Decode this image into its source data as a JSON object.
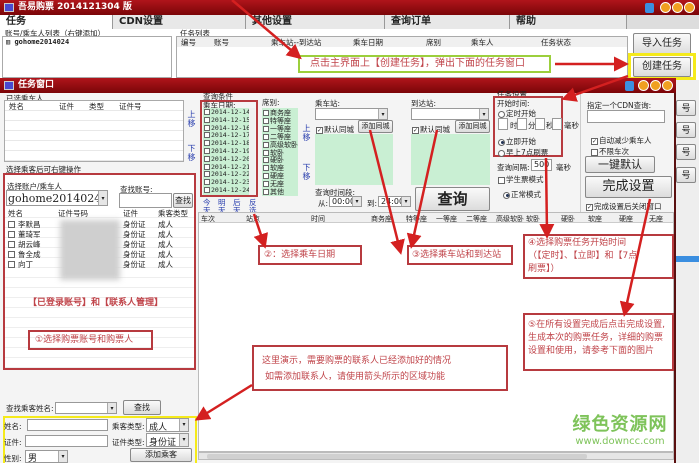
{
  "main_window": {
    "title": "吾易购票 2014121304 版",
    "tabs": [
      "任务",
      "CDN设置",
      "其他设置",
      "查询订单",
      "帮助"
    ],
    "account_list_label": "账号/乘车人列表（右键添加）",
    "account_item": "gohome2014024",
    "task_list_label": "任务列表",
    "task_list_headers": [
      "编号",
      "账号",
      "乘车站--到达站",
      "乘车日期",
      "席别",
      "乘车人",
      "任务状态"
    ],
    "import_task_button": "导入任务",
    "create_task_button": "创建任务",
    "side_button_fragment": "号"
  },
  "task_window": {
    "title": "任务窗口",
    "selected_passengers_label": "已选乘车人",
    "selected_headers": [
      "姓名",
      "证件",
      "类型",
      "证件号"
    ],
    "move_up": "上移",
    "move_down": "下移",
    "right_click_hint": "选择乘客后可右键操作",
    "select_account_label": "选择账户/乘车人",
    "account_value": "gohome2014024",
    "find_account_label": "查找账号:",
    "find_button": "查找",
    "passenger_headers": [
      "姓名",
      "证件号码",
      "证件",
      "乘客类型"
    ],
    "passengers": [
      {
        "name": "李默昌",
        "id_type": "身份证",
        "type": "成人"
      },
      {
        "name": "董琦军",
        "id_type": "身份证",
        "type": "成人"
      },
      {
        "name": "胡云峰",
        "id_type": "身份证",
        "type": "成人"
      },
      {
        "name": "鲁全成",
        "id_type": "身份证",
        "type": "成人"
      },
      {
        "name": "向丁",
        "id_type": "身份证",
        "type": "成人"
      }
    ],
    "find_passenger_label": "查找乘客姓名:",
    "add_form": {
      "name_label": "姓名:",
      "id_label": "证件:",
      "gender_label": "性别:",
      "gender_value": "男",
      "passenger_type_label": "乘客类型:",
      "passenger_type_value": "成人",
      "id_type_label": "证件类型:",
      "id_type_value": "身份证",
      "add_button": "添加乘客"
    },
    "query": {
      "label": "查询条件",
      "date_label": "乘车日期:",
      "dates": [
        "2014-12-14",
        "2014-12-15",
        "2014-12-16",
        "2014-12-17",
        "2014-12-18",
        "2014-12-19",
        "2014-12-20",
        "2014-12-21",
        "2014-12-22",
        "2014-12-23",
        "2014-12-24"
      ],
      "day_buttons": [
        "今天",
        "明天",
        "后天",
        "反选"
      ],
      "seat_label": "席别:",
      "seats": [
        "商务座",
        "特等座",
        "一等座",
        "二等座",
        "高级软卧",
        "软卧",
        "硬卧",
        "软座",
        "硬座",
        "无座",
        "其他"
      ],
      "from_label": "乘车站:",
      "to_label": "到达站:",
      "default_same_city": "默认同城",
      "add_same_city": "添加同城",
      "time_range_label": "查询时间段:",
      "from_time_label": "从:",
      "from_time": "00:00",
      "to_time_label": "到:",
      "to_time": "24:00",
      "query_button": "查询"
    },
    "task_settings": {
      "label": "任务设置",
      "start_time_label": "开始时间:",
      "scheduled": "定时开始",
      "hour": "时",
      "minute": "分",
      "second": "秒",
      "ms": "毫秒",
      "immediate": "立即开始",
      "morning7": "早上7点刷票",
      "interval_label": "查询间隔:",
      "interval_value": "500",
      "interval_unit": "毫秒",
      "student_mode": "学生票模式",
      "normal_mode": "正常模式",
      "cdn_label": "指定一个CDN查询:",
      "auto_reduce": "自动减少乘车人",
      "no_train_limit": "不限车次",
      "one_key_default": "一键默认",
      "finish_button": "完成设置",
      "close_after_finish": "完成设置后关闭窗口"
    },
    "result_headers": [
      "车次",
      "站点",
      "时间",
      "商务座",
      "特等座",
      "一等座",
      "二等座",
      "高级软卧",
      "软卧",
      "硬卧",
      "软座",
      "硬座",
      "无座"
    ]
  },
  "annotations": {
    "create_hint": "点击主界面上【创建任务】，弹出下面的任务窗口",
    "account_hint": "【已登录账号】和【联系人管理】",
    "step1": "①选择购票账号和购票人",
    "step2": "②：选择乘车日期",
    "step3": "③选择乘车站和到达站",
    "step4_line1": "④选择购票任务开始时间",
    "step4_line2": "（【定时】、【立即】和【7点",
    "step4_line3": "刷票】）",
    "step5_line1": "⑤在所有设置完成后点击完成设置,",
    "step5_line2": "生成本次的购票任务，详细的购票",
    "step5_line3": "设置和使用，请参考下面的图片",
    "note_line1": "这里演示，需要购票的联系人已经添加好的情况",
    "note_line2": "如需添加联系人，请使用箭头所示的区域功能"
  },
  "watermark": {
    "name": "绿色资源网",
    "url": "www.downcc.com"
  },
  "colors": {
    "title_red": "#9b0d12",
    "annotation_red": "#c0444a",
    "list_green": "#c9efd3",
    "highlight_yellow": "#f5ea1a"
  }
}
